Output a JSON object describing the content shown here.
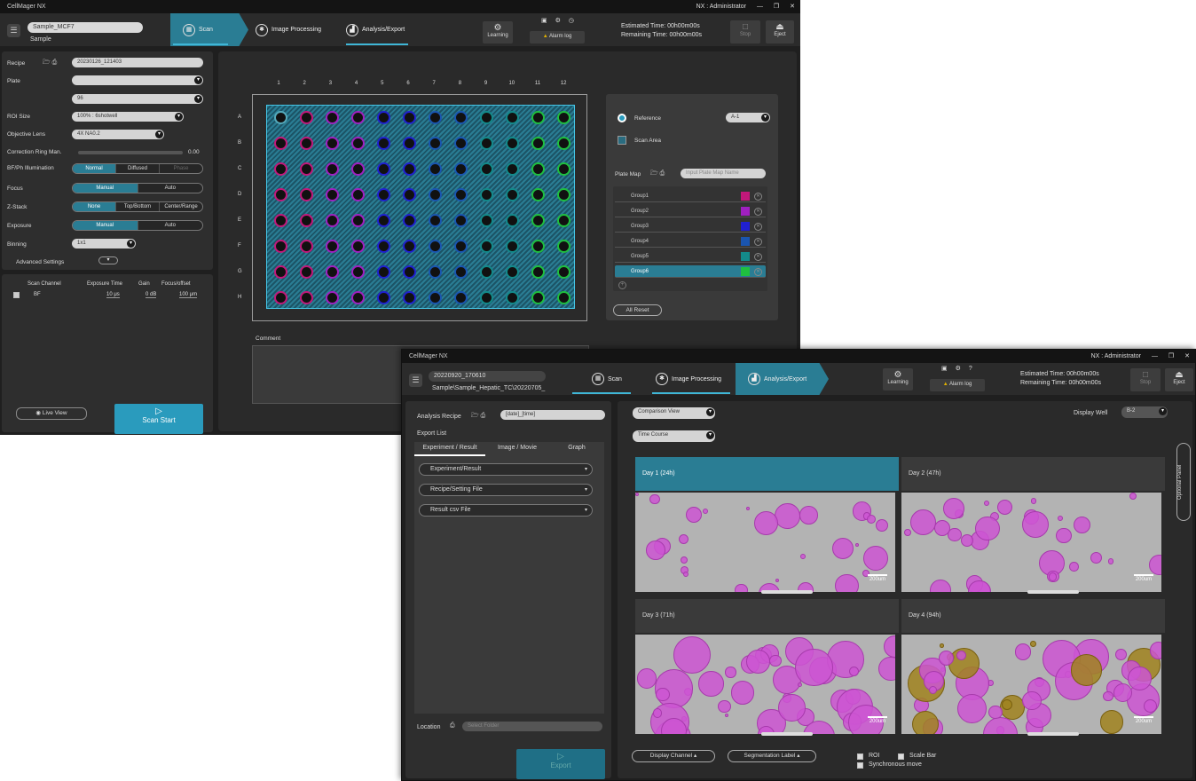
{
  "w1": {
    "title": "CellMager NX",
    "user": "NX : Administrator",
    "controls": [
      "—",
      "❐",
      "✕"
    ],
    "sample_name": "Sample_MCF7",
    "sample_sub": "Sample",
    "steps": [
      "Scan",
      "Image Processing",
      "Analysis/Export"
    ],
    "learning": "Learning",
    "alarm": "Alarm log",
    "estimated": "Estimated Time: 00h00m00s",
    "remaining": "Remaining Time: 00h00m00s",
    "stop": "Stop",
    "eject": "Eject",
    "settings": {
      "recipe_label": "Recipe",
      "recipe_value": "20230126_121403",
      "plate_label": "Plate",
      "plate_value": "",
      "plate_sub": "96",
      "roi_label": "ROI Size",
      "roi_value": "100% : 6shotwell",
      "obj_label": "Objective Lens",
      "obj_value": "4X NA0.2",
      "corr_label": "Correction Ring Man.",
      "corr_value": "0.00",
      "bf_label": "BF/Ph Illumination",
      "bf_opts": [
        "Normal",
        "Diffused",
        "Phase"
      ],
      "focus_label": "Focus",
      "focus_opts": [
        "Manual",
        "Auto"
      ],
      "zstack_label": "Z-Stack",
      "zstack_opts": [
        "None",
        "Top/Bottom",
        "Center/Range"
      ],
      "exposure_label": "Exposure",
      "exposure_opts": [
        "Manual",
        "Auto"
      ],
      "binning_label": "Binning",
      "binning_value": "1x1",
      "advanced": "Advanced Settings"
    },
    "channel_table": {
      "headers": [
        "Scan Channel",
        "Exposure Time",
        "Gain",
        "Focus/offset"
      ],
      "row": [
        "BF",
        "10 μs",
        "0 dB",
        "100 μm"
      ]
    },
    "live_view": "Live View",
    "scan_start": "Scan Start",
    "cols": [
      "1",
      "2",
      "3",
      "4",
      "5",
      "6",
      "7",
      "8",
      "9",
      "10",
      "11",
      "12"
    ],
    "rows": [
      "A",
      "B",
      "C",
      "D",
      "E",
      "F",
      "G",
      "H"
    ],
    "well_colors": [
      "#c2187a",
      "#c2187a",
      "#a020c0",
      "#a020c0",
      "#2020d0",
      "#2020d0",
      "#1a55b0",
      "#1a55b0",
      "#138a8a",
      "#138a8a",
      "#1fbf3f",
      "#1fbf3f"
    ],
    "reference": "Reference",
    "reference_value": "A-1",
    "scan_area": "Scan Area",
    "plate_map": "Plate Map",
    "plate_map_ph": "Input Plate Map Name",
    "groups": [
      {
        "name": "Group1",
        "color": "#c2187a"
      },
      {
        "name": "Group2",
        "color": "#a020c0"
      },
      {
        "name": "Group3",
        "color": "#2020d0"
      },
      {
        "name": "Group4",
        "color": "#1a55b0"
      },
      {
        "name": "Group5",
        "color": "#138a8a"
      },
      {
        "name": "Group6",
        "color": "#1fbf3f"
      }
    ],
    "all_reset": "All Reset",
    "comment": "Comment"
  },
  "w2": {
    "title": "CellMager NX",
    "user": "NX : Administrator",
    "controls": [
      "—",
      "❐",
      "✕"
    ],
    "sample_name": "20220920_170610",
    "sample_sub": "Sample\\Sample_Hepatic_TC\\20220705_",
    "steps": [
      "Scan",
      "Image Processing",
      "Analysis/Export"
    ],
    "learning": "Learning",
    "alarm": "Alarm log",
    "estimated": "Estimated Time: 00h00m00s",
    "remaining": "Remaining Time: 00h00m00s",
    "stop": "Stop",
    "eject": "Eject",
    "analysis_recipe": "Analysis Recipe",
    "recipe_value": "[date]_[time]",
    "export_list": "Export List",
    "tabs": [
      "Experiment / Result",
      "Image / Movie",
      "Graph"
    ],
    "accordions": [
      "Experiment/Result",
      "Recipe/Setting File",
      "Result csv File"
    ],
    "location": "Location",
    "location_ph": "Select Folder",
    "export": "Export",
    "comparison": "Comparison View",
    "time_course": "Time Course",
    "display_well_label": "Display Well",
    "display_well": "B-2",
    "optional_panel": "Optional Panel",
    "days": [
      "Day 1 (24h)",
      "Day 2 (47h)",
      "Day 3 (71h)",
      "Day 4 (94h)"
    ],
    "scale_label": "200um",
    "display_channel": "Display Channel",
    "segmentation": "Segmentation Label",
    "roi": "ROI",
    "scale_bar": "Scale Bar",
    "sync": "Synchronous move"
  }
}
